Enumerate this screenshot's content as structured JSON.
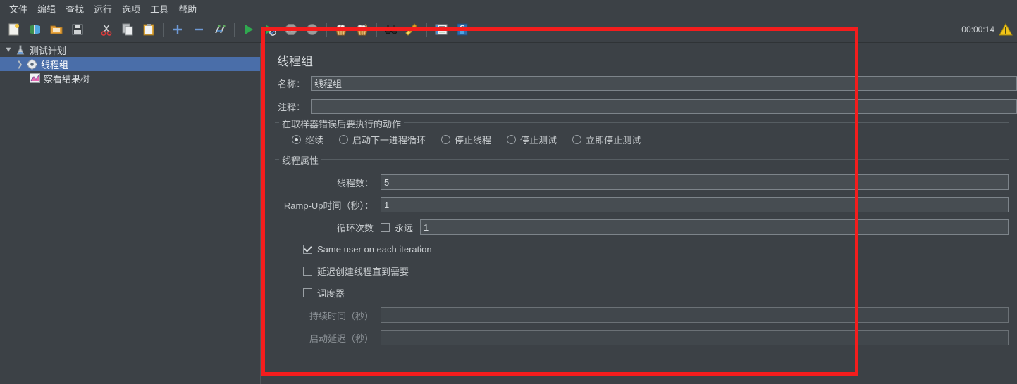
{
  "app": {
    "title": "JMeter Thread Group",
    "accent_selection": "#4a6ea9",
    "annotation_color": "#f41d1d",
    "background": "#3c4146"
  },
  "menubar": {
    "items": [
      {
        "label": "文件",
        "name": "menu-file"
      },
      {
        "label": "编辑",
        "name": "menu-edit"
      },
      {
        "label": "查找",
        "name": "menu-search"
      },
      {
        "label": "运行",
        "name": "menu-run"
      },
      {
        "label": "选项",
        "name": "menu-options"
      },
      {
        "label": "工具",
        "name": "menu-tools"
      },
      {
        "label": "帮助",
        "name": "menu-help"
      }
    ]
  },
  "toolbar": {
    "icons": [
      "new-icon",
      "templates-icon",
      "open-icon",
      "save-icon",
      "cut-icon",
      "copy-icon",
      "paste-icon",
      "expand-icon",
      "collapse-icon",
      "toggle-icon",
      "start-icon",
      "start-no-pauses-icon",
      "stop-icon",
      "shutdown-icon",
      "clear-icon",
      "clear-all-icon",
      "search-icon",
      "search-reset-icon",
      "function-helper-icon",
      "help-icon"
    ],
    "timer": "00:00:14",
    "warning_icon": "warning-triangle-icon"
  },
  "tree": {
    "nodes": [
      {
        "label": "测试计划",
        "icon": "test-plan-icon",
        "toggle": "▼",
        "depth": 1,
        "selected": false,
        "name": "tree-node-test-plan"
      },
      {
        "label": "线程组",
        "icon": "thread-group-icon",
        "toggle": "❯",
        "depth": 2,
        "selected": true,
        "name": "tree-node-thread-group"
      },
      {
        "label": "察看结果树",
        "icon": "view-results-tree-icon",
        "toggle": "",
        "depth": 3,
        "selected": false,
        "name": "tree-node-view-results-tree"
      }
    ]
  },
  "main": {
    "title": "线程组",
    "name_label": "名称：",
    "name_value": "线程组",
    "comment_label": "注释：",
    "comment_value": "",
    "on_error": {
      "group_title": "在取样器错误后要执行的动作",
      "options": [
        {
          "label": "继续",
          "checked": true,
          "name": "radio-continue"
        },
        {
          "label": "启动下一进程循环",
          "checked": false,
          "name": "radio-start-next-loop"
        },
        {
          "label": "停止线程",
          "checked": false,
          "name": "radio-stop-thread"
        },
        {
          "label": "停止测试",
          "checked": false,
          "name": "radio-stop-test"
        },
        {
          "label": "立即停止测试",
          "checked": false,
          "name": "radio-stop-test-now"
        }
      ]
    },
    "thread_props": {
      "group_title": "线程属性",
      "num_threads_label": "线程数：",
      "num_threads_value": "5",
      "ramp_up_label": "Ramp-Up时间（秒）：",
      "ramp_up_value": "1",
      "loop_label": "循环次数",
      "loop_forever_label": "永远",
      "loop_forever_checked": false,
      "loop_value": "1",
      "same_user_label": "Same user on each iteration",
      "same_user_checked": true,
      "delayed_start_label": "延迟创建线程直到需要",
      "delayed_start_checked": false,
      "scheduler_label": "调度器",
      "scheduler_checked": false,
      "duration_label": "持续时间（秒）",
      "duration_value": "",
      "duration_disabled": true,
      "startup_delay_label": "启动延迟（秒）",
      "startup_delay_value": ""
    }
  }
}
